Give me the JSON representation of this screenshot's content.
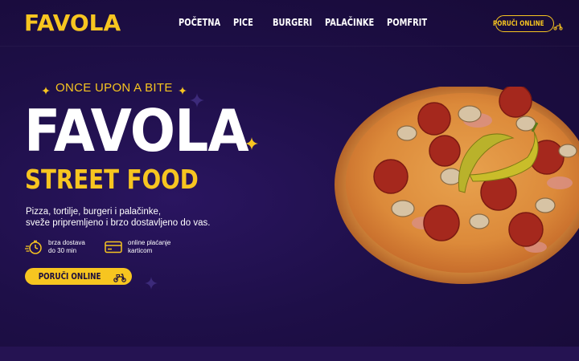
{
  "brand": {
    "logo": "FAVOLA"
  },
  "nav": {
    "links": [
      "POČETNA",
      "PICE",
      "BURGERI",
      "PALAČINKE",
      "POMFRIT"
    ],
    "order_button": "PORUČI ONLINE",
    "order_icon": "scooter-icon"
  },
  "hero": {
    "tagline": "ONCE UPON A BITE",
    "title": "FAVOLA",
    "subtitle": "STREET FOOD",
    "description_lines": [
      "Pizza, tortilje, burgeri i palačinke,",
      "sveže pripremljeno i brzo dostavljeno do vas."
    ],
    "features": [
      {
        "icon": "stopwatch-icon",
        "line1": "brza dostava",
        "line2": "do 30 min"
      },
      {
        "icon": "credit-card-icon",
        "line1": "online plaćanje",
        "line2": "karticom"
      }
    ],
    "cta_label": "PORUČI ONLINE",
    "cta_icon": "scooter-icon"
  },
  "colors": {
    "background": "#1b0d3d",
    "accent": "#f7c520",
    "text": "#ffffff"
  }
}
